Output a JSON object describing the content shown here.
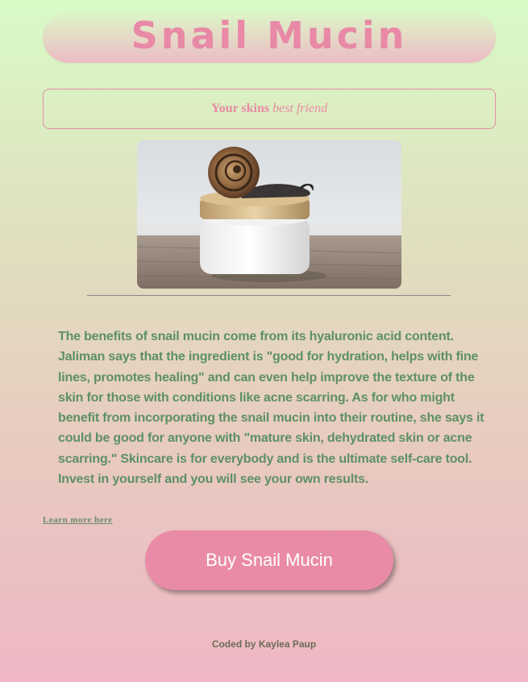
{
  "header": {
    "title": "Snail Mucin"
  },
  "tagline": {
    "part1": "Your skins",
    "part2": "best friend"
  },
  "image": {
    "alt": "Snail on a jar of skin cream",
    "icon": "product-photo"
  },
  "description": "The benefits of snail mucin come from its hyaluronic acid content. Jaliman says that the ingredient is \"good for hydration, helps with fine lines, promotes healing\" and can even help improve the texture of the skin for those with conditions like acne scarring. As for who might benefit from incorporating the snail mucin into their routine, she says it could be good for anyone with \"mature skin, dehydrated skin or acne scarring.\" Skincare is for everybody and is the ultimate self-care tool. Invest in yourself and you will see your own results.",
  "links": {
    "learn_more": "Learn more here"
  },
  "cta": {
    "buy_label": "Buy Snail Mucin"
  },
  "footer": {
    "credit": "Coded by Kaylea Paup"
  },
  "colors": {
    "accent": "#e98ba6",
    "text_green": "#5d9065"
  }
}
